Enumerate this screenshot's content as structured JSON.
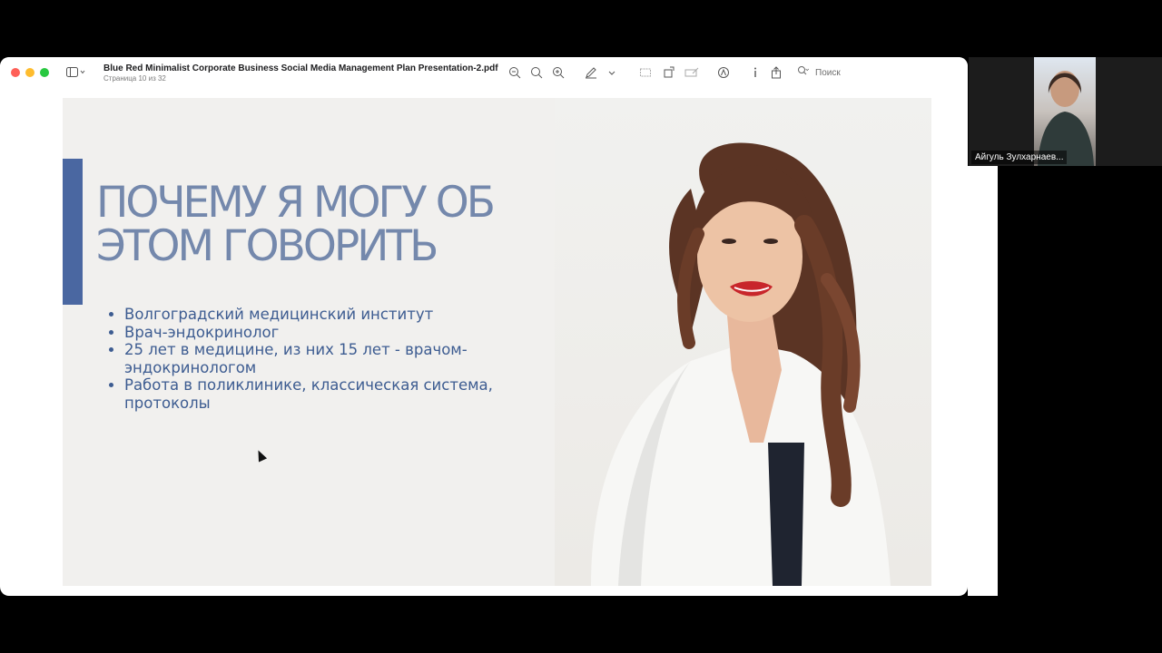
{
  "window": {
    "document_title": "Blue Red Minimalist Corporate Business Social Media Management Plan Presentation-2.pdf",
    "page_indicator": "Страница 10 из 32",
    "search_placeholder": "Поиск"
  },
  "slide": {
    "title": "ПОЧЕМУ Я МОГУ ОБ ЭТОМ ГОВОРИТЬ",
    "bullets": [
      "Волгоградский медицинский институт",
      "Врач-эндокринолог",
      "25 лет в медицине, из них 15 лет - врачом-эндокринологом",
      "Работа в поликлинике, классическая система, протоколы"
    ],
    "accent_color": "#4a67a1",
    "title_color": "#7488ac",
    "text_color": "#3d5c91"
  },
  "participant": {
    "name": "Айгуль Зулхарнаев..."
  }
}
